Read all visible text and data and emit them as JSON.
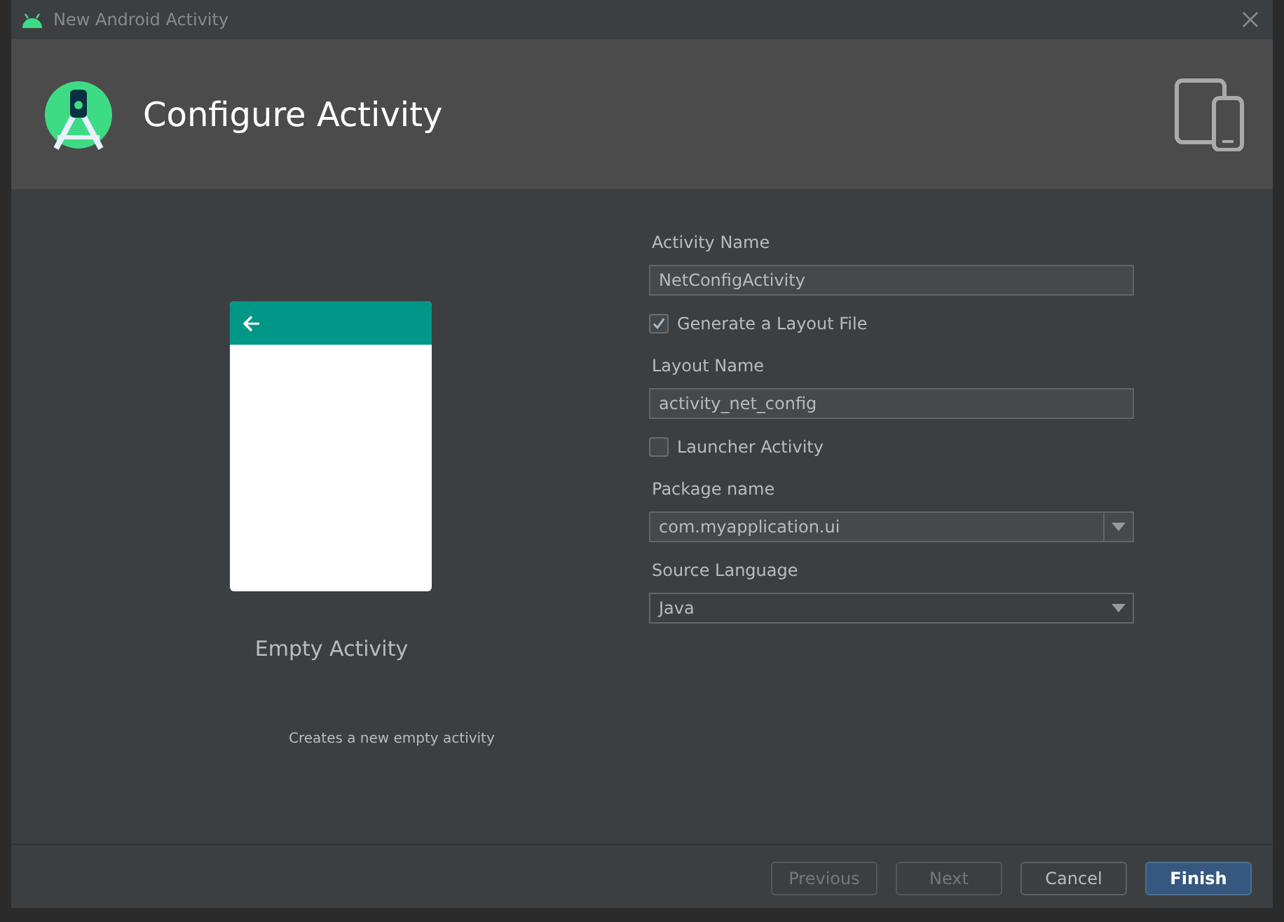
{
  "window": {
    "title": "New Android Activity"
  },
  "header": {
    "title": "Configure Activity"
  },
  "preview": {
    "name": "Empty Activity",
    "description": "Creates a new empty activity"
  },
  "form": [
    {
      "kind": "text",
      "label": "Activity Name",
      "value": "NetConfigActivity"
    },
    {
      "kind": "checkbox",
      "label": "Generate a Layout File",
      "checked": true
    },
    {
      "kind": "text",
      "label": "Layout Name",
      "value": "activity_net_config"
    },
    {
      "kind": "checkbox",
      "label": "Launcher Activity",
      "checked": false
    },
    {
      "kind": "combo",
      "label": "Package name",
      "value": "com.myapplication.ui"
    },
    {
      "kind": "dropdown",
      "label": "Source Language",
      "value": "Java"
    }
  ],
  "buttons": [
    {
      "label": "Previous",
      "disabled": true,
      "primary": false
    },
    {
      "label": "Next",
      "disabled": true,
      "primary": false
    },
    {
      "label": "Cancel",
      "disabled": false,
      "primary": false
    },
    {
      "label": "Finish",
      "disabled": false,
      "primary": true
    }
  ]
}
